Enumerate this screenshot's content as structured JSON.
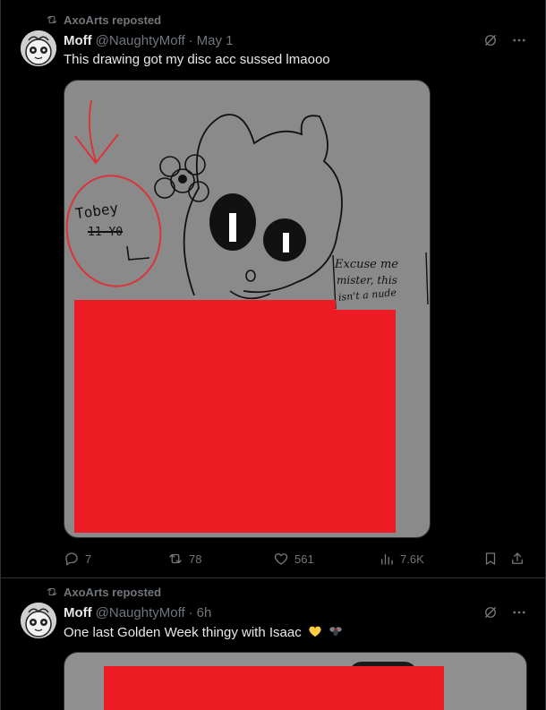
{
  "posts": [
    {
      "repost_label": "AxoArts reposted",
      "author_name": "Moff",
      "author_handle": "@NaughtyMoff",
      "separator": "·",
      "time": "May 1",
      "text": "This drawing got my disc acc sussed lmaooo",
      "drawing": {
        "label_name": "Tobey",
        "label_struck": "11 Y0",
        "speech": [
          "Excuse me",
          "mister, this",
          "isn't a nude"
        ]
      },
      "actions": {
        "replies": "7",
        "reposts": "78",
        "likes": "561",
        "views": "7.6K"
      }
    },
    {
      "repost_label": "AxoArts reposted",
      "author_name": "Moff",
      "author_handle": "@NaughtyMoff",
      "separator": "·",
      "time": "6h",
      "text": "One last Golden Week thingy with Isaac",
      "emojis": [
        "yellow-heart-emoji",
        "fly-emoji"
      ]
    }
  ],
  "colors": {
    "background": "#000000",
    "text": "#e7e9ea",
    "muted": "#71767b",
    "redaction": "#ed1c24",
    "media_gray": "#8a8a8a"
  }
}
